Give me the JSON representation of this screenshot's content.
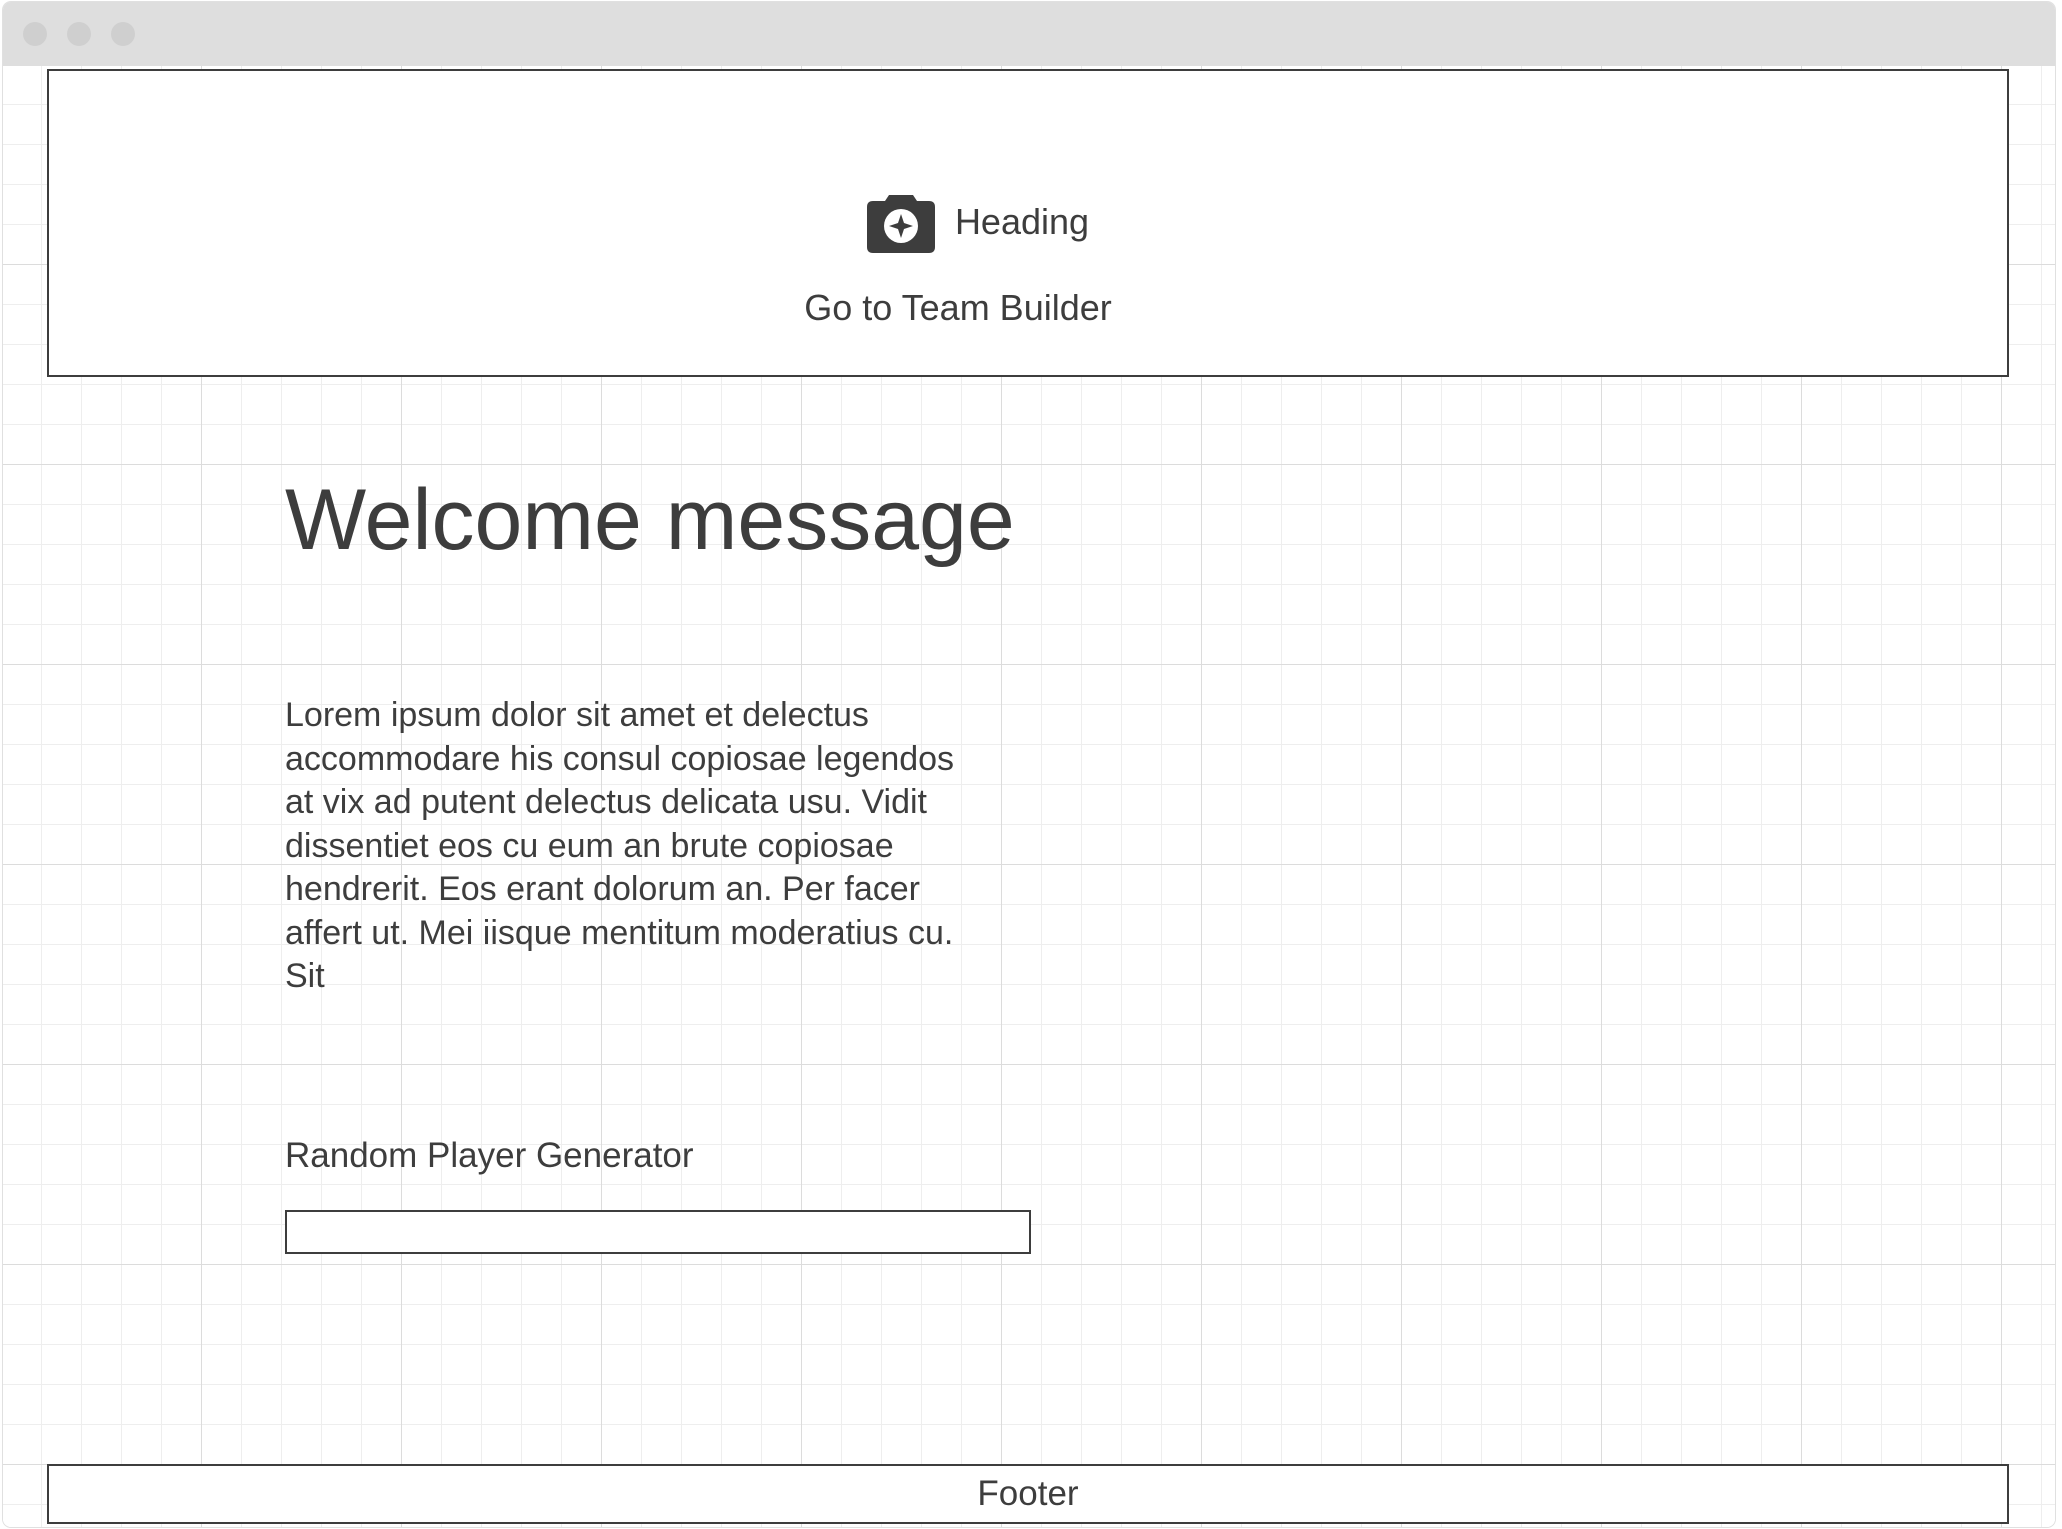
{
  "header": {
    "heading": "Heading",
    "icon": "camera-icon",
    "nav_link": "Go to Team Builder"
  },
  "main": {
    "welcome_title": "Welcome message",
    "body_text": "Lorem ipsum dolor sit amet et delectus accommodare his consul copiosae legendos at vix ad putent delectus delicata usu. Vidit dissentiet eos cu eum an brute copiosae hendrerit. Eos erant dolorum an. Per facer affert ut. Mei iisque mentitum moderatius cu. Sit",
    "generator_label": "Random Player Generator",
    "generator_input_value": ""
  },
  "footer": {
    "text": "Footer"
  },
  "colors": {
    "text": "#3d3d3d",
    "titlebar": "#dedede",
    "window_dot": "#cfcfcf"
  }
}
